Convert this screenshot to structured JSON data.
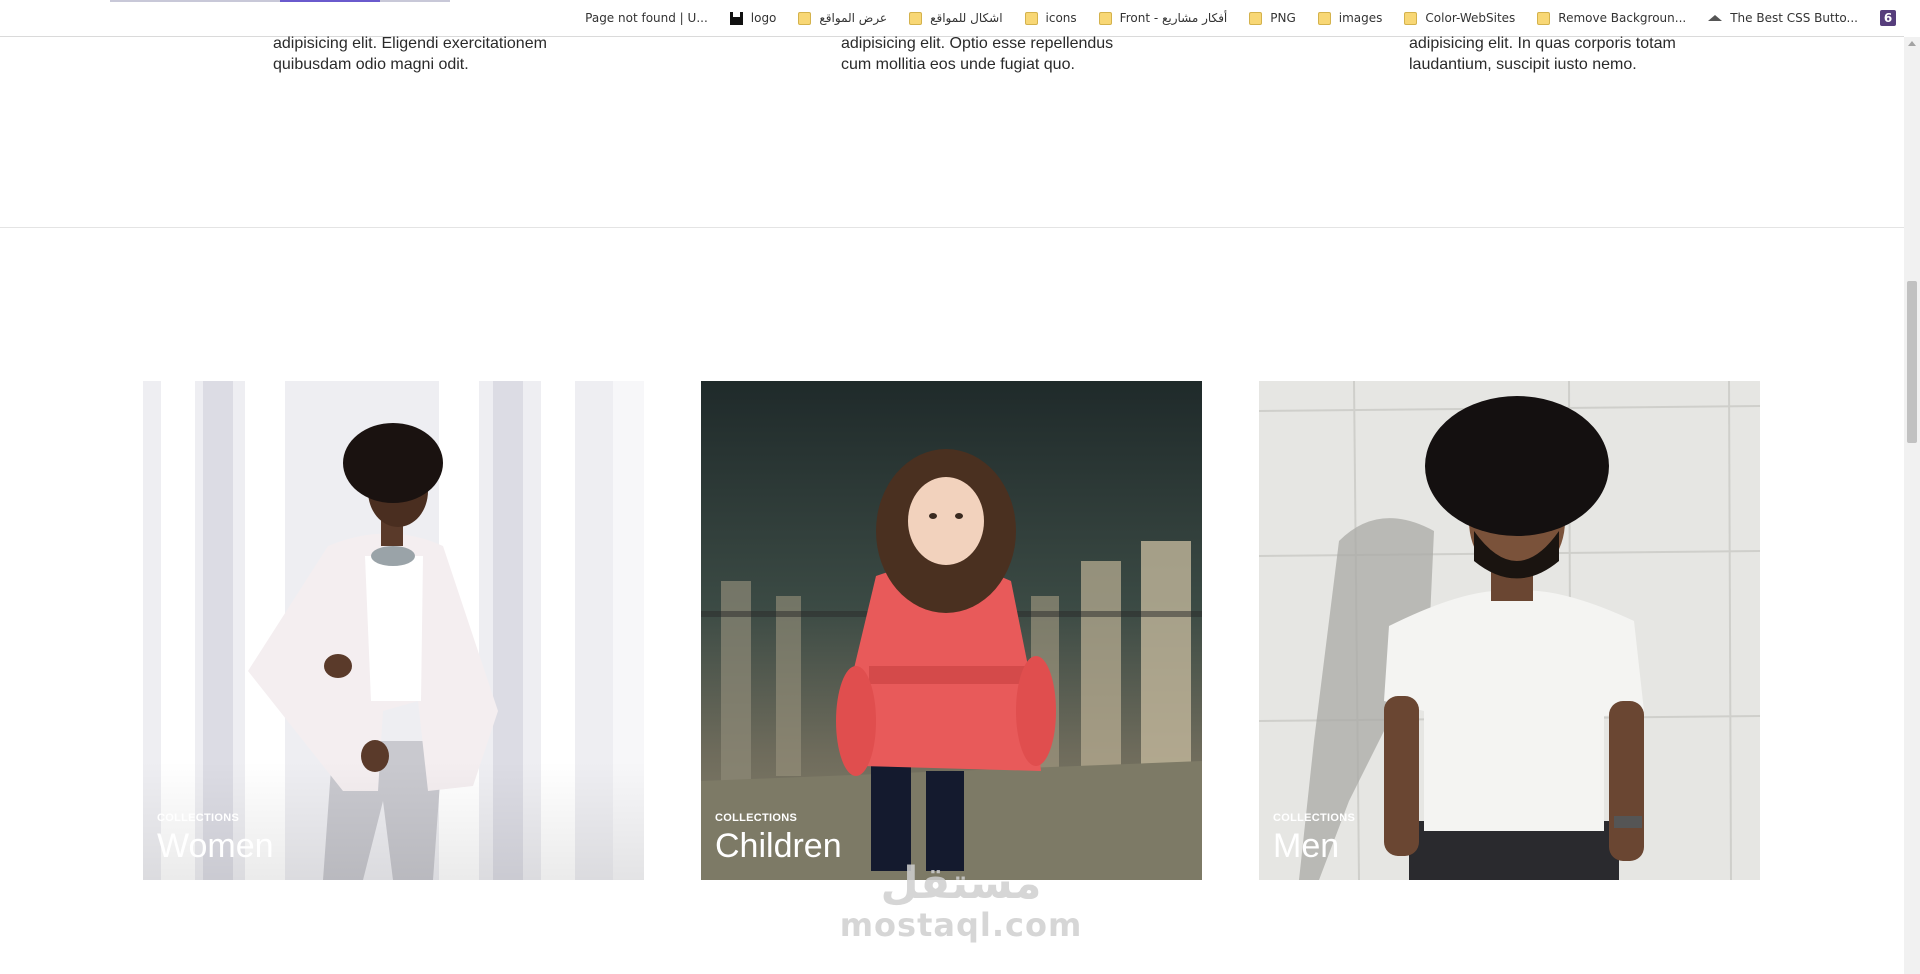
{
  "browser": {
    "bookmarks": [
      {
        "label": "Page not found | U...",
        "icon": "blank"
      },
      {
        "label": "logo",
        "icon": "black-square"
      },
      {
        "label": "عرض المواقع",
        "icon": "folder"
      },
      {
        "label": "اشكال للمواقع",
        "icon": "folder"
      },
      {
        "label": "icons",
        "icon": "folder"
      },
      {
        "label": "Front - أفكار مشاريع",
        "icon": "folder"
      },
      {
        "label": "PNG",
        "icon": "folder"
      },
      {
        "label": "images",
        "icon": "folder"
      },
      {
        "label": "Color-WebSites",
        "icon": "folder"
      },
      {
        "label": "Remove Backgroun...",
        "icon": "folder"
      },
      {
        "label": "The Best CSS Butto...",
        "icon": "layers"
      }
    ],
    "bootstrap_icon_label": "6"
  },
  "features": {
    "columns": [
      {
        "text_line_1": "adipisicing elit. Eligendi exercitationem",
        "text_line_2": "quibusdam odio magni odit."
      },
      {
        "text_line_1": "adipisicing elit. Optio esse repellendus",
        "text_line_2": "cum mollitia eos unde fugiat quo."
      },
      {
        "text_line_1": "adipisicing elit. In quas corporis totam",
        "text_line_2": "laudantium, suscipit iusto nemo."
      }
    ]
  },
  "collections": {
    "cards": [
      {
        "kicker": "COLLECTIONS",
        "title": "Women"
      },
      {
        "kicker": "COLLECTIONS",
        "title": "Children"
      },
      {
        "kicker": "COLLECTIONS",
        "title": "Men"
      }
    ]
  },
  "watermark": {
    "arabic": "مستقل",
    "latin": "mostaql.com"
  },
  "colors": {
    "folder": "#f8d775",
    "bootstrap": "#563d7c",
    "divider": "#e4e4e4"
  }
}
